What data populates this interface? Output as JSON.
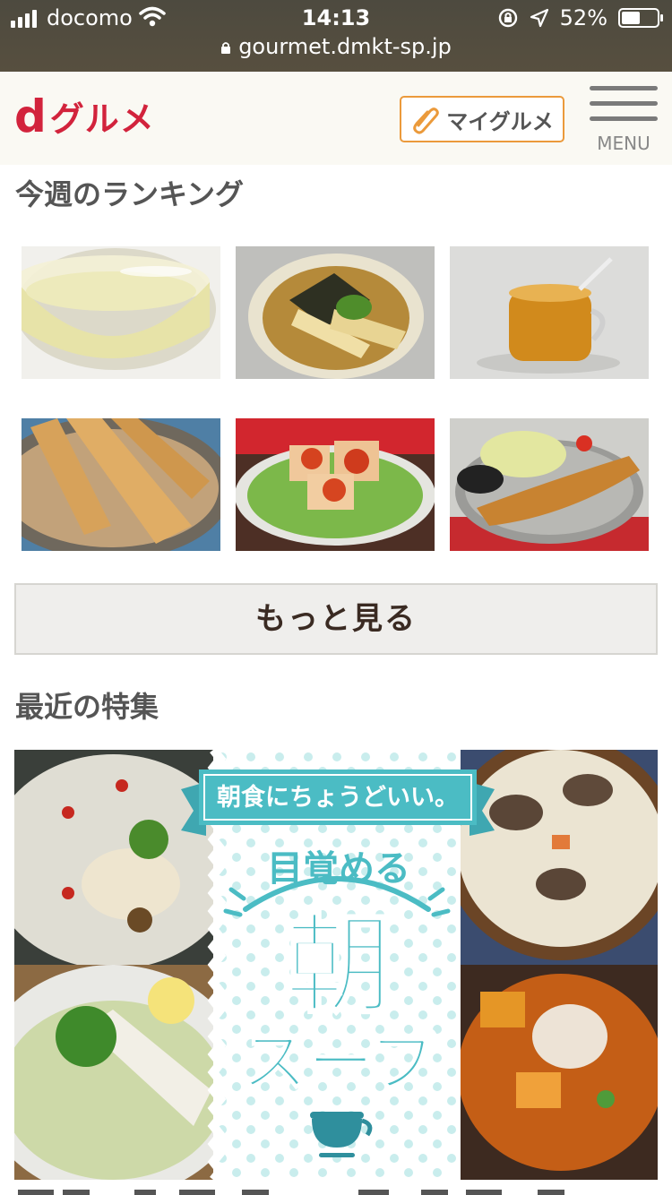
{
  "status_bar": {
    "carrier": "docomo",
    "time": "14:13",
    "battery": "52%",
    "battery_level": 0.52
  },
  "browser": {
    "url": "gourmet.dmkt-sp.jp"
  },
  "header": {
    "logo_d": "d",
    "logo_text": "グルメ",
    "my_gourmet_label": "マイグルメ",
    "menu_label": "MENU"
  },
  "ranking": {
    "title": "今週のランキング",
    "items": [
      {
        "icon": "clear-soup-photo"
      },
      {
        "icon": "simmered-bamboo-shoot-photo"
      },
      {
        "icon": "amber-tea-photo"
      },
      {
        "icon": "grilled-bamboo-shoot-photo"
      },
      {
        "icon": "tofu-chili-sauce-photo"
      },
      {
        "icon": "fried-fish-cutlet-photo"
      }
    ],
    "more_label": "もっと見る"
  },
  "features": {
    "title": "最近の特集",
    "banner": {
      "ribbon_text": "朝食にちょうどいい。",
      "headline_small": "目覚める",
      "headline_kanji": "朝",
      "headline_katakana": "スープ"
    }
  },
  "colors": {
    "brand_red": "#d2233c",
    "button_orange": "#eb9a3b",
    "teal": "#4bbcc4"
  }
}
